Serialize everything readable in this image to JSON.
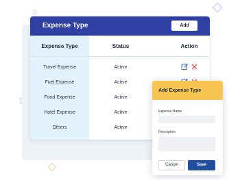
{
  "header": {
    "title": "Expense Type",
    "add_label": "Add"
  },
  "table": {
    "columns": [
      "Expense Type",
      "Status",
      "Action"
    ],
    "rows": [
      {
        "type": "Travel Expense",
        "status": "Active"
      },
      {
        "type": "Fuel Expense",
        "status": "Active"
      },
      {
        "type": "Food Expense",
        "status": "Active"
      },
      {
        "type": "Hotel Expense",
        "status": "Active"
      },
      {
        "type": "Others",
        "status": "Active"
      }
    ]
  },
  "modal": {
    "title": "Add Expense Type",
    "name_label": "Expense Name",
    "name_value": "",
    "description_label": "Description",
    "description_value": "",
    "cancel_label": "Cancel",
    "save_label": "Save"
  },
  "icons": {
    "edit": "pencil-square-icon",
    "delete": "x-icon"
  },
  "colors": {
    "header_bg": "#2f3fa2",
    "type_column_bg": "#e3f3fb",
    "modal_header_bg": "#f8c553",
    "save_bg": "#1f4f9e",
    "edit_icon": "#2f6fce",
    "delete_icon": "#e0393e"
  }
}
